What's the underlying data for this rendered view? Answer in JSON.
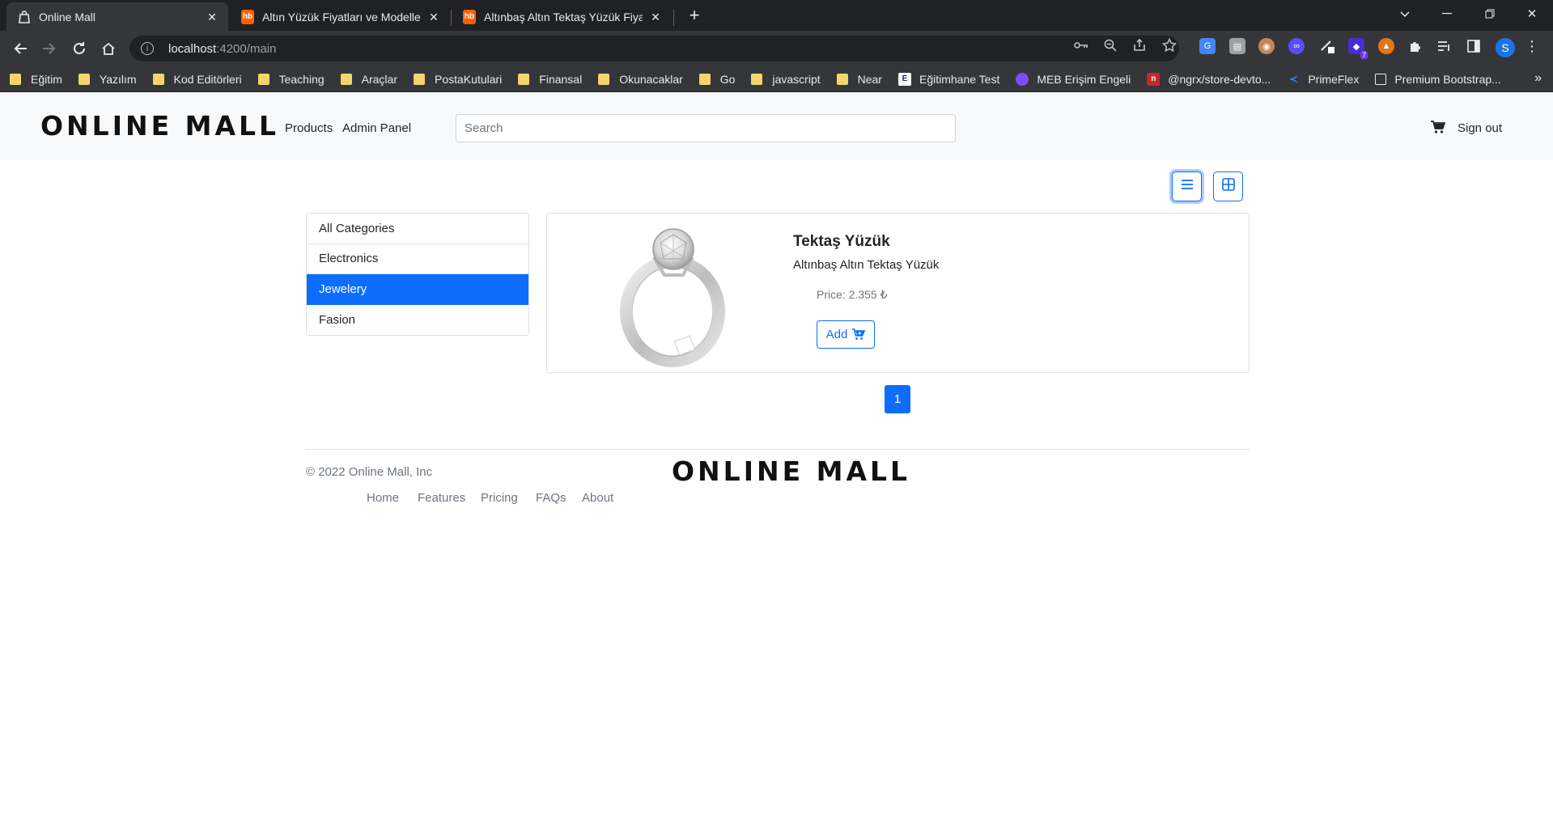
{
  "browser": {
    "tabs": [
      {
        "title": "Online Mall",
        "active": true
      },
      {
        "title": "Altın Yüzük Fiyatları ve Modelleri",
        "favicon": "hb"
      },
      {
        "title": "Altınbaş Altın Tektaş Yüzük Fiyatı",
        "favicon": "hb"
      }
    ],
    "url_host": "localhost",
    "url_path": ":4200/main",
    "bookmarks": [
      "Eğitim",
      "Yazılım",
      "Kod Editörleri",
      "Teaching",
      "Araçlar",
      "PostaKutulari",
      "Finansal",
      "Okunacaklar",
      "Go",
      "javascript",
      "Near"
    ],
    "bookmark_links": [
      {
        "label": "Eğitimhane Test",
        "icon": "E"
      },
      {
        "label": "MEB Erişim Engeli",
        "icon": ""
      },
      {
        "label": "@ngrx/store-devto...",
        "icon": "n"
      },
      {
        "label": "PrimeFlex",
        "icon": ""
      },
      {
        "label": "Premium Bootstrap...",
        "icon": ""
      }
    ],
    "profile_initial": "S",
    "extension_badge": "7"
  },
  "header": {
    "brand": "ONLINE MALL",
    "nav": [
      "Products",
      "Admin Panel"
    ],
    "search_placeholder": "Search",
    "signout": "Sign out"
  },
  "view_modes": {
    "list_active": true
  },
  "categories": [
    {
      "label": "All Categories",
      "active": false
    },
    {
      "label": "Electronics",
      "active": false
    },
    {
      "label": "Jewelery",
      "active": true
    },
    {
      "label": "Fasion",
      "active": false
    }
  ],
  "product": {
    "name": "Tektaş Yüzük",
    "description": "Altınbaş Altın Tektaş Yüzük",
    "price": "Price: 2.355 ₺",
    "add_label": "Add"
  },
  "pagination": {
    "current": "1"
  },
  "footer": {
    "copyright": "© 2022 Online Mall, Inc",
    "brand": "ONLINE MALL",
    "links": [
      "Home",
      "Features",
      "Pricing",
      "FAQs",
      "About"
    ]
  },
  "colors": {
    "primary": "#0d6efd",
    "header_bg": "#f8f9fa",
    "chrome_dark": "#202124",
    "chrome_toolbar": "#35363a"
  }
}
